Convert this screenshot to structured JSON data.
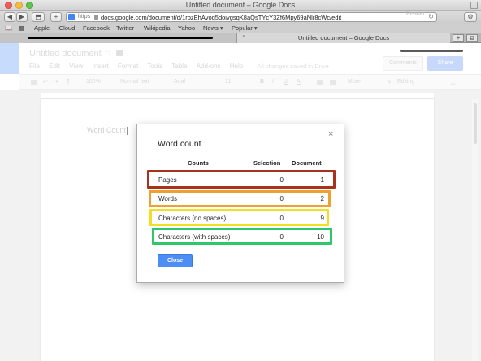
{
  "window": {
    "title": "Untitled document – Google Docs"
  },
  "browser": {
    "url_scheme": "https",
    "url": "docs.google.com/document/d/1rbzEhAvoq5doivgsqK8aQsTYcY3Zf6Mpy69aNlr8cWc/edit",
    "reader_label": "Reader",
    "bookmarks": [
      "Apple",
      "iCloud",
      "Facebook",
      "Twitter",
      "Wikipedia",
      "Yahoo",
      "News ▾",
      "Popular ▾"
    ],
    "active_tab_title": "Untitled document – Google Docs"
  },
  "docs": {
    "title": "Untitled document",
    "menu": [
      "File",
      "Edit",
      "View",
      "Insert",
      "Format",
      "Tools",
      "Table",
      "Add-ons",
      "Help"
    ],
    "saved_status": "All changes saved in Drive",
    "comments_label": "Comments",
    "share_label": "Share",
    "toolbar": {
      "zoom": "100%",
      "style": "Normal text",
      "font": "Arial",
      "size": "11",
      "more": "More",
      "mode": "Editing"
    },
    "body_text": "Word Count"
  },
  "dialog": {
    "title": "Word count",
    "headers": {
      "counts": "Counts",
      "selection": "Selection",
      "document": "Document"
    },
    "rows": [
      {
        "label": "Pages",
        "selection": "0",
        "document": "1"
      },
      {
        "label": "Words",
        "selection": "0",
        "document": "2"
      },
      {
        "label": "Characters (no spaces)",
        "selection": "0",
        "document": "9"
      },
      {
        "label": "Characters (with spaces)",
        "selection": "0",
        "document": "10"
      }
    ],
    "close_label": "Close",
    "close_glyph": "×"
  },
  "highlight_colors": [
    "#a8321c",
    "#f0a030",
    "#f2df24",
    "#2fc76b"
  ]
}
